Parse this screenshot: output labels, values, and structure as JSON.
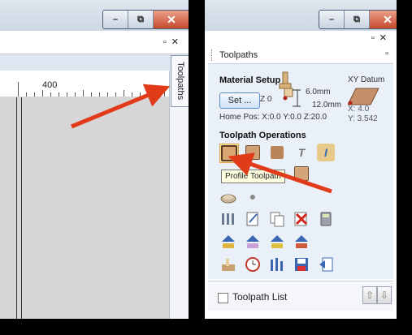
{
  "left_panel": {
    "window_buttons": {
      "minimize": "–",
      "restore": "⧉",
      "close": "✕"
    },
    "pin_close": "▫✕",
    "ruler_label": "400",
    "side_tab_label": "Toolpaths"
  },
  "right_panel": {
    "window_buttons": {
      "minimize": "–",
      "restore": "⧉",
      "close": "✕"
    },
    "pin_close": "▫✕",
    "header": {
      "title": "Toolpaths",
      "pin": "▫"
    },
    "material_setup": {
      "title": "Material Setup",
      "set_button": "Set ...",
      "z_label": "Z 0",
      "top_thickness": "6.0mm",
      "bottom_thickness": "12.0mm",
      "home_pos": "Home Pos:  X:0.0 Y:0.0 Z:20.0",
      "xy_datum_title": "XY Datum",
      "xy_x": "X: 4.0",
      "xy_y": "Y: 3.542"
    },
    "toolpath_operations": {
      "title": "Toolpath Operations",
      "tooltip": "Profile Toolpath",
      "icon_glyphs": {
        "text": "T",
        "italic": "I",
        "sphere": "●"
      }
    },
    "footer": {
      "list_label": "Toolpath List",
      "up": "⇧",
      "down": "⇩"
    }
  },
  "colors": {
    "arrow": "#e23b1a",
    "panel_bg": "#eaf0f7",
    "titlebar": "#cdd6e2",
    "close_btn": "#c6482c"
  }
}
